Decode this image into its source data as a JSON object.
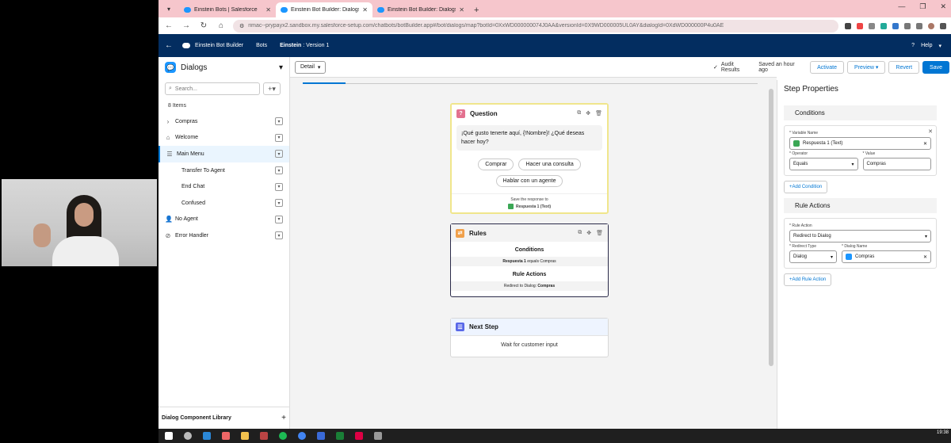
{
  "browser": {
    "tabs": [
      {
        "label": "Einstein Bots | Salesforce",
        "active": false
      },
      {
        "label": "Einstein Bot Builder: Dialogs",
        "active": true
      },
      {
        "label": "Einstein Bot Builder: Dialogs",
        "active": false
      }
    ],
    "url_host": "rimac--prypayx2.sandbox.my.salesforce-setup.com",
    "url_path": "/chatbots/botBuilder.app#/bot/dialogs/map?botId=0XxWD000000074J0AA&versionId=0X9WD000005UL0AY&dialogId=0XdWD000000P4u0AE"
  },
  "sfheader": {
    "app_name": "Einstein Bot Builder",
    "bots_label": "Bots",
    "bot_name": "Einstein",
    "version": " : Version 1",
    "help_label": "Help"
  },
  "left_panel": {
    "title": "Dialogs",
    "search_placeholder": "Search...",
    "add_symbol": "+",
    "count": "8 Items",
    "items": [
      {
        "label": "Compras",
        "icon": ">"
      },
      {
        "label": "Welcome",
        "icon": "home"
      },
      {
        "label": "Main Menu",
        "icon": "menu"
      },
      {
        "label": "Transfer To Agent",
        "icon": ""
      },
      {
        "label": "End Chat",
        "icon": ""
      },
      {
        "label": "Confused",
        "icon": ""
      },
      {
        "label": "No Agent",
        "icon": "user"
      },
      {
        "label": "Error Handler",
        "icon": "error"
      }
    ],
    "footer": "Dialog Component Library"
  },
  "canvas": {
    "detail_label": "Detail",
    "audit_label": "Audit Results",
    "saved_label": "Saved an hour ago",
    "activate_label": "Activate",
    "preview_label": "Preview",
    "revert_label": "Revert",
    "save_label": "Save",
    "question_card": {
      "title": "Question",
      "text": "¡Qué gusto tenerte aquí, {!Nombre}! ¿Qué deseas hacer hoy?",
      "chips": [
        "Comprar",
        "Hacer una consulta",
        "Hablar con un agente"
      ],
      "save_label": "Save the response to",
      "save_var": "Respuesta 1 (Text)"
    },
    "rules_card": {
      "title": "Rules",
      "conditions_label": "Conditions",
      "condition_var": "Respuesta 1",
      "condition_rest": " equals Compras",
      "actions_label": "Rule Actions",
      "action_prefix": "Redirect to Dialog: ",
      "action_target": "Compras"
    },
    "next_card": {
      "title": "Next Step",
      "text": "Wait for customer input"
    }
  },
  "right_panel": {
    "title": "Step Properties",
    "conditions_header": "Conditions",
    "variable_label": "* Variable Name",
    "variable_value": "Respuesta 1 (Text)",
    "operator_label": "* Operator",
    "operator_value": "Equals",
    "value_label": "* Value",
    "value_value": "Compras",
    "add_condition": "+Add Condition",
    "actions_header": "Rule Actions",
    "rule_action_label": "* Rule Action",
    "rule_action_value": "Redirect to Dialog",
    "redirect_type_label": "* Redirect Type",
    "redirect_type_value": "Dialog",
    "dialog_name_label": "* Dialog Name",
    "dialog_name_value": "Compras",
    "add_rule_action": "+Add Rule Action"
  },
  "taskbar": {
    "time": "19:38"
  },
  "colors": {
    "sf_header": "#032d60",
    "brand_blue": "#0176d3",
    "tab_bar": "#f6c6cc"
  }
}
